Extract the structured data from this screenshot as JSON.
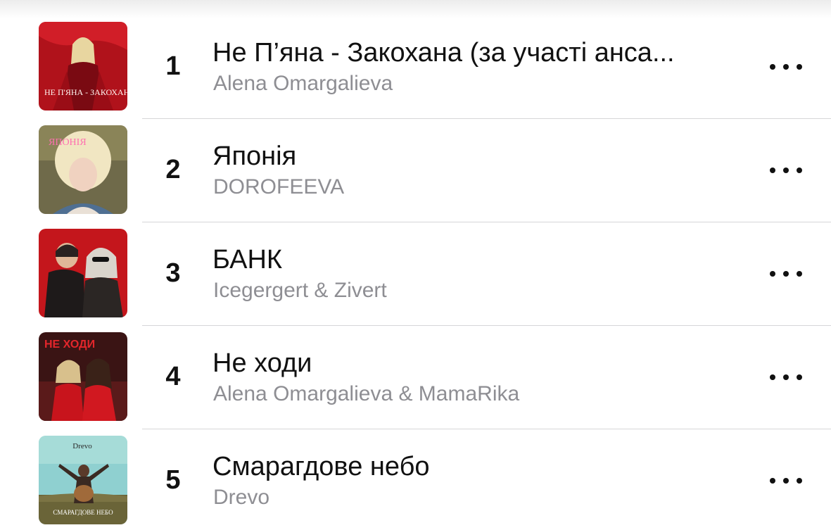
{
  "tracks": [
    {
      "rank": "1",
      "title": "Не П’яна - Закохана (за участі анса...",
      "artist": "Alena Omargalieva",
      "more_icon": "ellipsis-icon",
      "artwork_icon": "album-artwork"
    },
    {
      "rank": "2",
      "title": "Японія",
      "artist": "DOROFEEVA",
      "more_icon": "ellipsis-icon",
      "artwork_icon": "album-artwork"
    },
    {
      "rank": "3",
      "title": "БАНК",
      "artist": "Icegergert & Zivert",
      "more_icon": "ellipsis-icon",
      "artwork_icon": "album-artwork"
    },
    {
      "rank": "4",
      "title": "Не ходи",
      "artist": "Alena Omargalieva & MamaRika",
      "more_icon": "ellipsis-icon",
      "artwork_icon": "album-artwork"
    },
    {
      "rank": "5",
      "title": "Смарагдове небо",
      "artist": "Drevo",
      "more_icon": "ellipsis-icon",
      "artwork_icon": "album-artwork"
    }
  ],
  "artwork_text": {
    "art1": "НЕ П'ЯНА - ЗАКОХАНА",
    "art2": "ЯПОНІЯ",
    "art4": "НЕ ХОДИ",
    "art5": "СМАРАГДОВЕ НЕБО"
  },
  "colors": {
    "title": "#111111",
    "artist": "#8e8e93",
    "divider": "#d6d6d8"
  }
}
